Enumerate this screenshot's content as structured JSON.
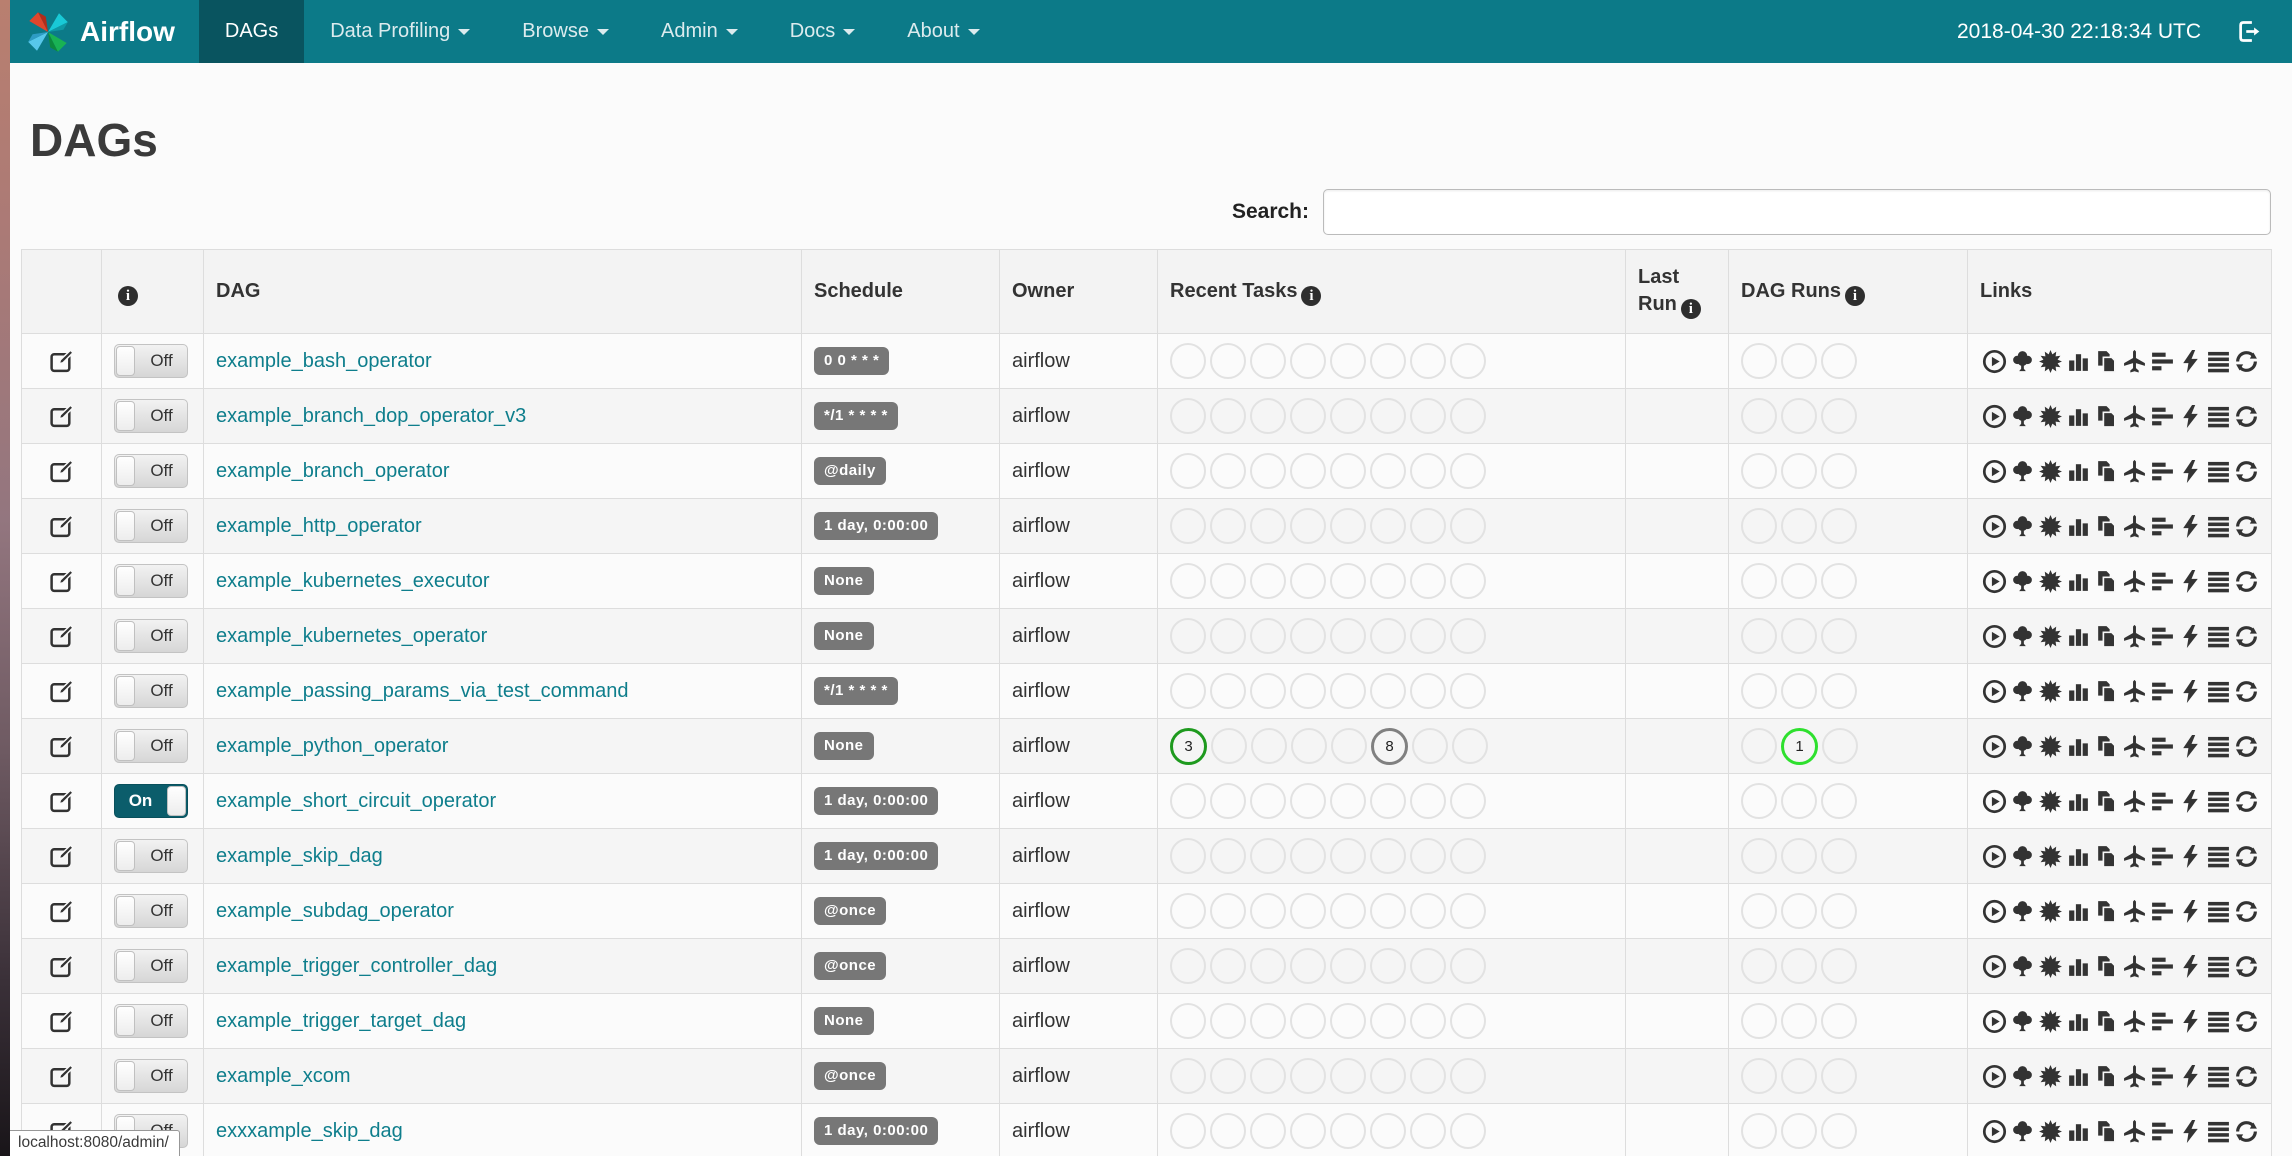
{
  "navbar": {
    "brand": "Airflow",
    "items": [
      {
        "label": "DAGs",
        "active": true,
        "dropdown": false
      },
      {
        "label": "Data Profiling",
        "active": false,
        "dropdown": true
      },
      {
        "label": "Browse",
        "active": false,
        "dropdown": true
      },
      {
        "label": "Admin",
        "active": false,
        "dropdown": true
      },
      {
        "label": "Docs",
        "active": false,
        "dropdown": true
      },
      {
        "label": "About",
        "active": false,
        "dropdown": true
      }
    ],
    "clock": "2018-04-30 22:18:34 UTC",
    "logout_icon": "sign-out-icon"
  },
  "page": {
    "title": "DAGs",
    "search_label": "Search:",
    "search_value": "",
    "status_bar": "localhost:8080/admin/"
  },
  "table": {
    "info_glyph": "i",
    "headers": {
      "dag": "DAG",
      "schedule": "Schedule",
      "owner": "Owner",
      "recent_tasks": "Recent Tasks",
      "last_run": "Last Run",
      "dag_runs": "DAG Runs",
      "links": "Links"
    },
    "recent_slots": 8,
    "dag_run_slots": 3,
    "rows": [
      {
        "name": "example_bash_operator",
        "schedule": "0 0 * * *",
        "owner": "airflow",
        "toggle": "Off",
        "recent_tasks": [],
        "dag_runs": [],
        "last_run": ""
      },
      {
        "name": "example_branch_dop_operator_v3",
        "schedule": "*/1 * * * *",
        "owner": "airflow",
        "toggle": "Off",
        "recent_tasks": [],
        "dag_runs": [],
        "last_run": ""
      },
      {
        "name": "example_branch_operator",
        "schedule": "@daily",
        "owner": "airflow",
        "toggle": "Off",
        "recent_tasks": [],
        "dag_runs": [],
        "last_run": ""
      },
      {
        "name": "example_http_operator",
        "schedule": "1 day, 0:00:00",
        "owner": "airflow",
        "toggle": "Off",
        "recent_tasks": [],
        "dag_runs": [],
        "last_run": ""
      },
      {
        "name": "example_kubernetes_executor",
        "schedule": "None",
        "owner": "airflow",
        "toggle": "Off",
        "recent_tasks": [],
        "dag_runs": [],
        "last_run": ""
      },
      {
        "name": "example_kubernetes_operator",
        "schedule": "None",
        "owner": "airflow",
        "toggle": "Off",
        "recent_tasks": [],
        "dag_runs": [],
        "last_run": ""
      },
      {
        "name": "example_passing_params_via_test_command",
        "schedule": "*/1 * * * *",
        "owner": "airflow",
        "toggle": "Off",
        "recent_tasks": [],
        "dag_runs": [],
        "last_run": ""
      },
      {
        "name": "example_python_operator",
        "schedule": "None",
        "owner": "airflow",
        "toggle": "Off",
        "recent_tasks": [
          {
            "slot": 0,
            "count": "3",
            "state": "success"
          },
          {
            "slot": 5,
            "count": "8",
            "state": "queued"
          }
        ],
        "dag_runs": [
          {
            "slot": 1,
            "count": "1",
            "state": "running"
          }
        ],
        "last_run": ""
      },
      {
        "name": "example_short_circuit_operator",
        "schedule": "1 day, 0:00:00",
        "owner": "airflow",
        "toggle": "On",
        "recent_tasks": [],
        "dag_runs": [],
        "last_run": ""
      },
      {
        "name": "example_skip_dag",
        "schedule": "1 day, 0:00:00",
        "owner": "airflow",
        "toggle": "Off",
        "recent_tasks": [],
        "dag_runs": [],
        "last_run": ""
      },
      {
        "name": "example_subdag_operator",
        "schedule": "@once",
        "owner": "airflow",
        "toggle": "Off",
        "recent_tasks": [],
        "dag_runs": [],
        "last_run": ""
      },
      {
        "name": "example_trigger_controller_dag",
        "schedule": "@once",
        "owner": "airflow",
        "toggle": "Off",
        "recent_tasks": [],
        "dag_runs": [],
        "last_run": ""
      },
      {
        "name": "example_trigger_target_dag",
        "schedule": "None",
        "owner": "airflow",
        "toggle": "Off",
        "recent_tasks": [],
        "dag_runs": [],
        "last_run": ""
      },
      {
        "name": "example_xcom",
        "schedule": "@once",
        "owner": "airflow",
        "toggle": "Off",
        "recent_tasks": [],
        "dag_runs": [],
        "last_run": ""
      },
      {
        "name": "exxxample_skip_dag",
        "schedule": "1 day, 0:00:00",
        "owner": "airflow",
        "toggle": "Off",
        "recent_tasks": [],
        "dag_runs": [],
        "last_run": ""
      }
    ]
  },
  "links": [
    "trigger-dag",
    "tree-view",
    "graph-view",
    "task-duration",
    "task-tries",
    "landing-times",
    "gantt-view",
    "code-view",
    "logs",
    "refresh"
  ],
  "colors": {
    "navbar_bg": "#0C7A88",
    "navbar_active_bg": "#09545F",
    "teal_link": "#0E7E8C",
    "teal_icon": "#0E8294",
    "badge_bg": "#777777",
    "toggle_on_bg": "#0B5D6B",
    "circle_empty_border": "#E2E2E2",
    "task_state_colors": {
      "success": "#1E9A1E",
      "queued": "#808080",
      "running": "#2EE02E"
    }
  }
}
